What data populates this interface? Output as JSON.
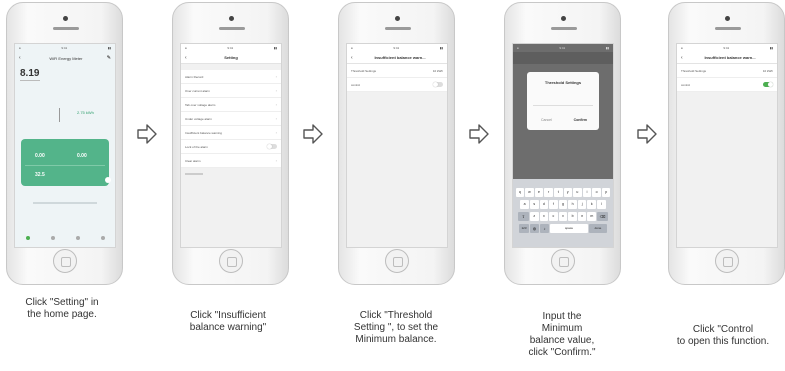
{
  "steps": [
    {
      "caption_lines": [
        "Click \"Setting\" in",
        "the home page."
      ],
      "screen": {
        "device_name": "WiFi Energy Meter",
        "balance": "8.19",
        "energy_value": "2.75 kWh",
        "card_values": [
          "0.00",
          "0.00",
          "32.5"
        ]
      }
    },
    {
      "caption_lines": [
        "Click \"Insufficient",
        "balance warning\""
      ],
      "screen": {
        "title": "Setting",
        "items": [
          "Alarm Record",
          "Over current alarm",
          "Tab over voltage alarm",
          "Under voltage alarm",
          "Insufficient balance warning",
          "Lock of the alarm",
          "Clear alarm"
        ]
      }
    },
    {
      "caption_lines": [
        "Click \"Threshold",
        "Setting \", to set the",
        "Minimum balance."
      ],
      "screen": {
        "title": "Insufficient balance warn...",
        "row1_label": "Threshold Settings",
        "row1_value": "10 kWh",
        "row2_label": "control"
      }
    },
    {
      "caption_lines": [
        "Input the",
        "Minimum",
        "balance value,",
        "click \"Confirm.\""
      ],
      "screen": {
        "dialog_title": "Threshold Settings",
        "cancel": "Cancel",
        "confirm": "Confirm",
        "keys_row1": [
          "q",
          "w",
          "e",
          "r",
          "t",
          "y",
          "u",
          "i",
          "o",
          "p"
        ],
        "keys_row2": [
          "a",
          "s",
          "d",
          "f",
          "g",
          "h",
          "j",
          "k",
          "l"
        ],
        "keys_row3": [
          "z",
          "x",
          "c",
          "v",
          "b",
          "n",
          "m"
        ],
        "space": "space",
        "done": "done"
      }
    },
    {
      "caption_lines": [
        "Click \"Control",
        "to open this function."
      ],
      "screen": {
        "title": "Insufficient balance warn...",
        "row1_label": "Threshold Settings",
        "row1_value": "10 kWh",
        "row2_label": "control"
      }
    }
  ]
}
